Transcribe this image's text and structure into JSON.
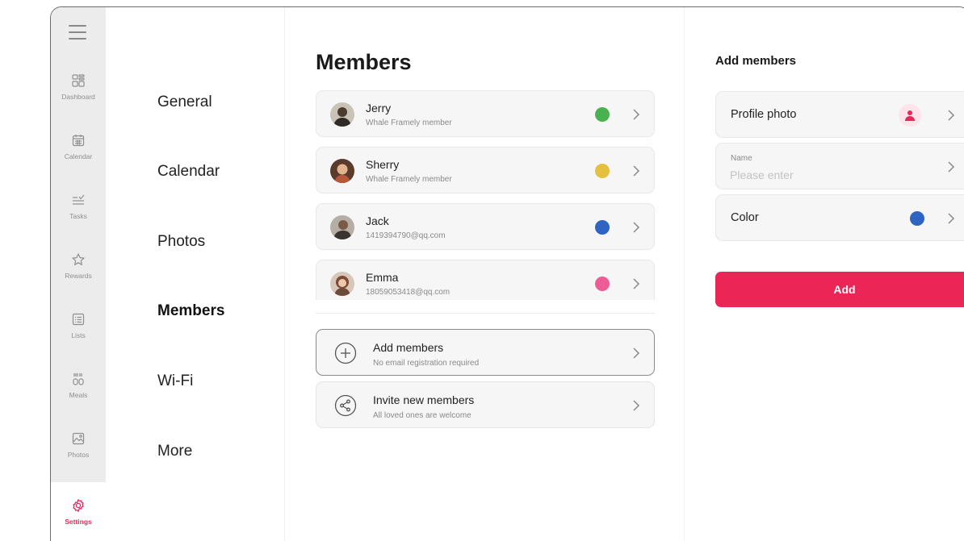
{
  "rail": {
    "items": [
      {
        "label": "Dashboard",
        "icon": "dashboard-icon"
      },
      {
        "label": "Calendar",
        "icon": "calendar-icon"
      },
      {
        "label": "Tasks",
        "icon": "tasks-icon"
      },
      {
        "label": "Rewards",
        "icon": "star-icon"
      },
      {
        "label": "Lists",
        "icon": "list-icon"
      },
      {
        "label": "Meals",
        "icon": "meals-icon"
      },
      {
        "label": "Photos",
        "icon": "photo-icon"
      },
      {
        "label": "Settings",
        "icon": "gear-icon"
      }
    ],
    "active": "Settings"
  },
  "settings_menu": {
    "items": [
      "General",
      "Calendar",
      "Photos",
      "Members",
      "Wi-Fi",
      "More"
    ],
    "active": "Members"
  },
  "members": {
    "title": "Members",
    "list": [
      {
        "name": "Jerry",
        "subtitle": "Whale Framely member",
        "color": "#49b24e"
      },
      {
        "name": "Sherry",
        "subtitle": "Whale Framely member",
        "color": "#e3c13e"
      },
      {
        "name": "Jack",
        "subtitle": "1419394790@qq.com",
        "color": "#2f64c3"
      },
      {
        "name": "Emma",
        "subtitle": "18059053418@qq.com",
        "color": "#ee5c96"
      }
    ],
    "actions": [
      {
        "title": "Add members",
        "subtitle": "No email registration required",
        "icon": "plus-circle-icon"
      },
      {
        "title": "Invite new members",
        "subtitle": "All loved ones are welcome",
        "icon": "share-icon"
      }
    ]
  },
  "add_panel": {
    "title": "Add members",
    "profile_photo_label": "Profile photo",
    "name_caption": "Name",
    "name_placeholder": "Please enter",
    "name_value": "",
    "color_label": "Color",
    "color_value": "#2f64c3",
    "add_button": "Add"
  },
  "colors": {
    "accent": "#eb2556",
    "rail_bg": "#ececec",
    "card_bg": "#f6f6f6"
  }
}
